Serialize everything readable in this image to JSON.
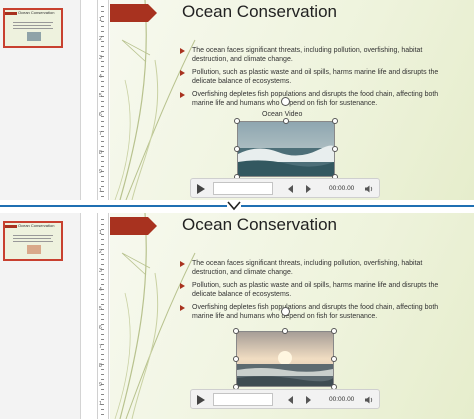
{
  "top": {
    "slide": {
      "title": "Ocean Conservation",
      "bullets": [
        "The ocean faces significant threats, including pollution, overfishing, habitat destruction, and climate change.",
        "Pollution, such as plastic waste and oil spills, harms marine life and disrupts the delicate balance of ecosystems.",
        "Overfishing depletes fish populations and disrupts the food chain, affecting both marine life and humans who depend on fish for sustenance."
      ],
      "video_label": "Ocean Video"
    },
    "thumbnail": {
      "title": "Ocean Conservation"
    },
    "controls": {
      "time": "00:00.00"
    }
  },
  "bottom": {
    "slide": {
      "title": "Ocean Conservation",
      "bullets": [
        "The ocean faces significant threats, including pollution, overfishing, habitat destruction, and climate change.",
        "Pollution, such as plastic waste and oil spills, harms marine life and disrupts the delicate balance of ecosystems.",
        "Overfishing depletes fish populations and disrupts the food chain, affecting both marine life and humans who depend on fish for sustenance."
      ]
    },
    "thumbnail": {
      "title": "Ocean Conservation"
    },
    "controls": {
      "time": "00:00.00"
    }
  },
  "ruler_numbers": [
    "1",
    "2",
    "3",
    "4",
    "5",
    "6",
    "7",
    "8",
    "9",
    "1"
  ],
  "colors": {
    "accent": "#a8321f",
    "divider": "#1f6fb2"
  },
  "icons": [
    "play-icon",
    "previous-frame-icon",
    "next-frame-icon",
    "volume-icon",
    "chevron-down-icon"
  ]
}
